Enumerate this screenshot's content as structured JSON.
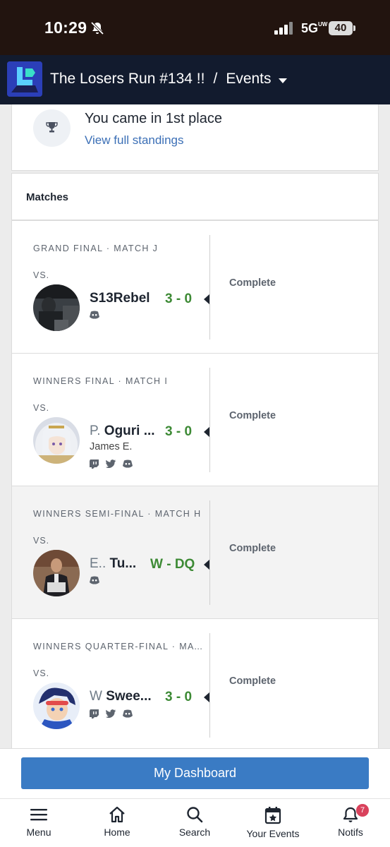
{
  "status_bar": {
    "time": "10:29",
    "network": "5G",
    "network_sup": "UW",
    "battery": "40"
  },
  "header": {
    "event": "The Losers Run #134 !!",
    "separator": "/",
    "section": "Events"
  },
  "placement": {
    "text": "You came in 1st place",
    "link": "View full standings"
  },
  "matches_title": "Matches",
  "matches": [
    {
      "round": "GRAND FINAL · MATCH J",
      "vs": "VS.",
      "prefix": "",
      "tag": "S13Rebel",
      "realname": "",
      "score": "3 - 0",
      "status": "Complete",
      "socials": [
        "discord-icon"
      ]
    },
    {
      "round": "WINNERS FINAL · MATCH I",
      "vs": "VS.",
      "prefix": "P.",
      "tag": "Oguri ...",
      "realname": "James E.",
      "score": "3 - 0",
      "status": "Complete",
      "socials": [
        "twitch-icon",
        "twitter-icon",
        "discord-icon"
      ]
    },
    {
      "round": "WINNERS SEMI-FINAL · MATCH H",
      "vs": "VS.",
      "prefix": "E..",
      "tag": "Tu...",
      "realname": "",
      "score": "W - DQ",
      "status": "Complete",
      "socials": [
        "discord-icon"
      ]
    },
    {
      "round": "WINNERS QUARTER-FINAL · MAT...",
      "vs": "VS.",
      "prefix": "W",
      "tag": "Swee...",
      "realname": "",
      "score": "3 - 0",
      "status": "Complete",
      "socials": [
        "twitch-icon",
        "twitter-icon",
        "discord-icon"
      ]
    }
  ],
  "dashboard_button": "My Dashboard",
  "nav": {
    "menu": "Menu",
    "home": "Home",
    "search": "Search",
    "your_events": "Your Events",
    "notifs": "Notifs",
    "notif_count": "7"
  },
  "colors": {
    "header_bg": "#121b2e",
    "accent": "#3a7bc4",
    "score_green": "#3d8a35",
    "badge": "#d9425c"
  }
}
